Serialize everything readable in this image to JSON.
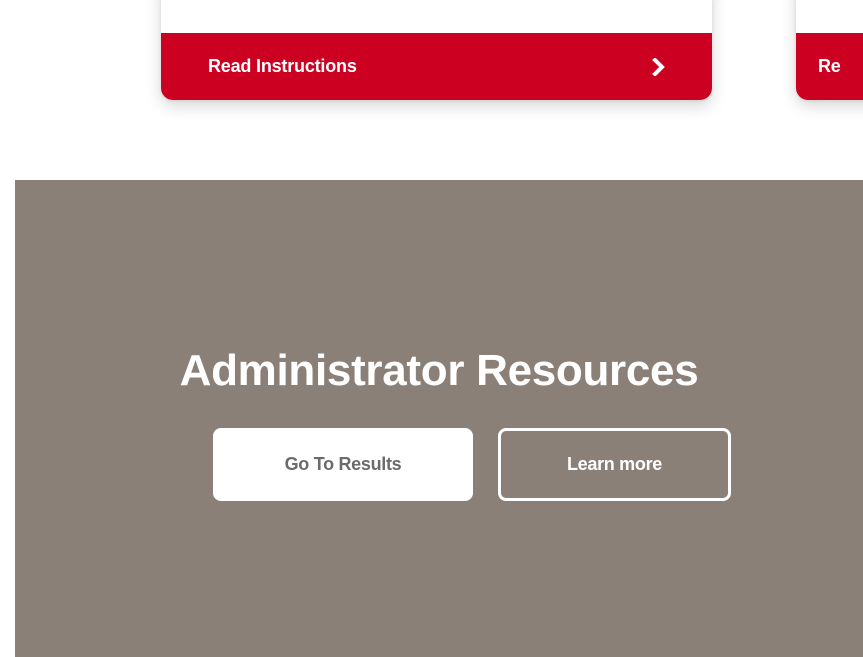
{
  "cards": [
    {
      "footer_label": "Read Instructions"
    },
    {
      "footer_label": "Re"
    }
  ],
  "admin": {
    "title": "Administrator Resources",
    "primary_button_label": "Go To Results",
    "secondary_button_label": "Learn more"
  },
  "colors": {
    "accent_red": "#cc0021",
    "section_bg": "#8a8078",
    "button_text_gray": "#6b6b6b"
  }
}
